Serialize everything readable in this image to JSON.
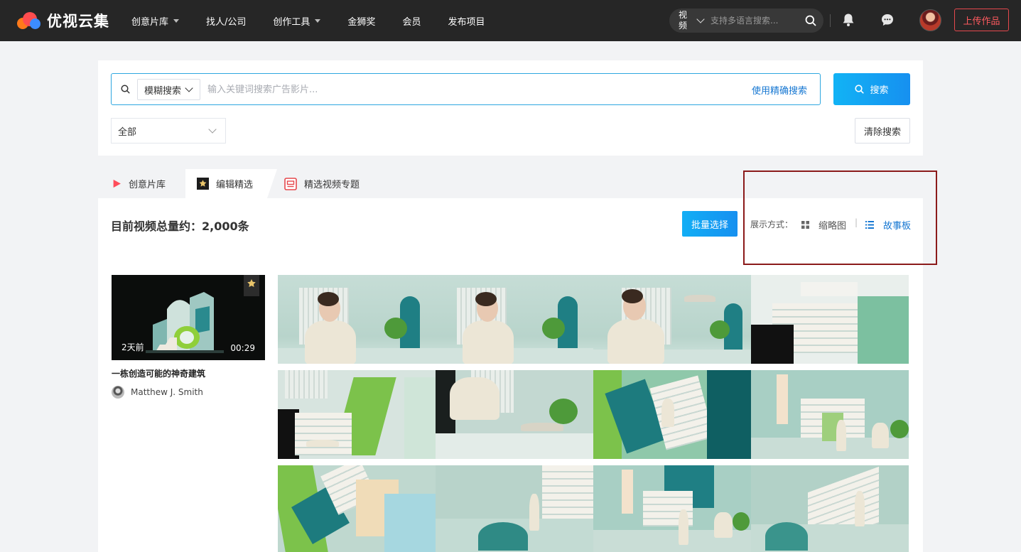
{
  "header": {
    "logo_text": "优视云集",
    "nav": [
      {
        "label": "创意片库",
        "has_dropdown": true
      },
      {
        "label": "找人/公司",
        "has_dropdown": false
      },
      {
        "label": "创作工具",
        "has_dropdown": true
      },
      {
        "label": "金狮奖",
        "has_dropdown": false
      },
      {
        "label": "会员",
        "has_dropdown": false
      },
      {
        "label": "发布项目",
        "has_dropdown": false
      }
    ],
    "search_type": "视频",
    "search_placeholder": "支持多语言搜索...",
    "upload_label": "上传作品"
  },
  "search": {
    "mode": "模糊搜索",
    "placeholder": "输入关键词搜索广告影片...",
    "precise_link": "使用精确搜索",
    "button_label": "搜索",
    "category": "全部",
    "clear_label": "清除搜索"
  },
  "tabs": [
    {
      "label": "创意片库",
      "active": false
    },
    {
      "label": "编辑精选",
      "active": true
    },
    {
      "label": "精选视频专题",
      "active": false
    }
  ],
  "toolbar": {
    "total_label": "目前视频总量约：2,000条",
    "batch_label": "批量选择",
    "display_label": "展示方式：",
    "view_thumbnail": "缩略图",
    "view_separator": "|",
    "view_storyboard": "故事板",
    "active_view": "故事板"
  },
  "video": {
    "age": "2天前",
    "duration": "00:29",
    "title": "一栋创造可能的神奇建筑",
    "author": "Matthew J. Smith"
  },
  "colors": {
    "accent": "#1677d2",
    "nav_bg": "#262626",
    "upload_red": "#e5484d",
    "highlight": "#8b1a1a"
  }
}
